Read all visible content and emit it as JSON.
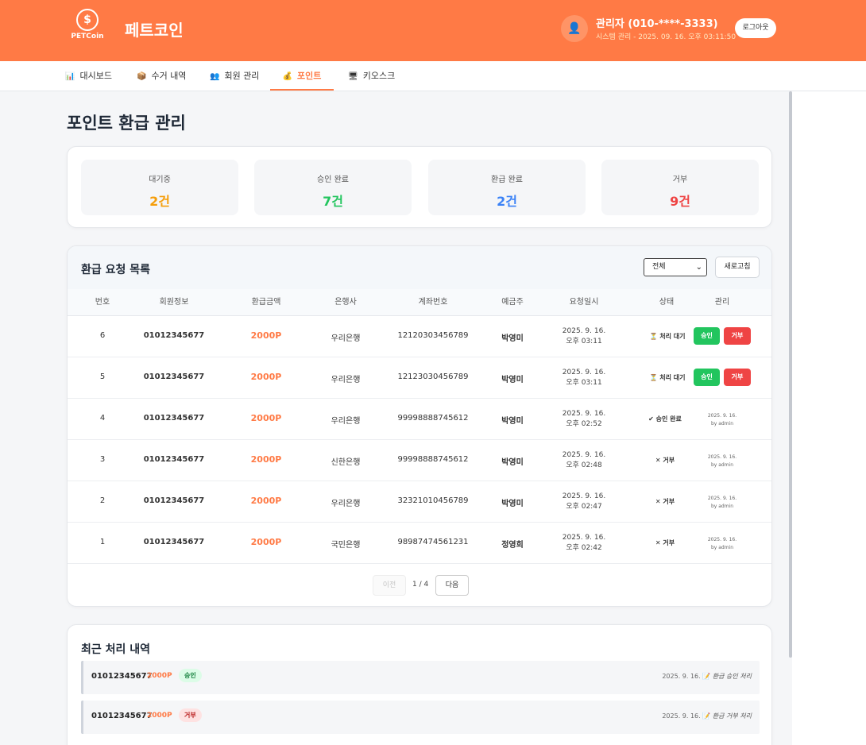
{
  "header": {
    "logo_text": "PETCoin",
    "brand": "페트코인",
    "admin_name": "관리자 (010-****-3333)",
    "admin_sub": "시스템 관리 - 2025. 09. 16. 오후 03:11:50",
    "logout": "로그아웃"
  },
  "nav": [
    {
      "icon": "📊",
      "label": "대시보드"
    },
    {
      "icon": "📦",
      "label": "수거 내역"
    },
    {
      "icon": "👥",
      "label": "회원 관리"
    },
    {
      "icon": "💰",
      "label": "포인트"
    },
    {
      "icon": "🖥",
      "label": "키오스크"
    }
  ],
  "page_title": "포인트 환급 관리",
  "stats": [
    {
      "label": "대기중",
      "value": "2건",
      "color": "#f59e0b"
    },
    {
      "label": "승인 완료",
      "value": "7건",
      "color": "#22c55e"
    },
    {
      "label": "환급 완료",
      "value": "2건",
      "color": "#3b82f6"
    },
    {
      "label": "거부",
      "value": "9건",
      "color": "#ef4444"
    }
  ],
  "list": {
    "title": "환급 요청 목록",
    "filter": "전체",
    "refresh": "새로고침",
    "columns": [
      "번호",
      "회원정보",
      "환급금액",
      "은행사",
      "계좌번호",
      "예금주",
      "요청일시",
      "상태",
      "관리"
    ],
    "rows": [
      {
        "no": "6",
        "member": "01012345677",
        "amount": "2000P",
        "bank": "우리은행",
        "account": "12120303456789",
        "holder": "박영미",
        "date1": "2025. 9. 16.",
        "date2": "오후 03:11",
        "status": "⏳ 처리 대기",
        "status_color": "#333333",
        "approve": "승인",
        "reject": "거부"
      },
      {
        "no": "5",
        "member": "01012345677",
        "amount": "2000P",
        "bank": "우리은행",
        "account": "12123030456789",
        "holder": "박영미",
        "date1": "2025. 9. 16.",
        "date2": "오후 03:11",
        "status": "⏳ 처리 대기",
        "status_color": "#333333",
        "approve": "승인",
        "reject": "거부"
      },
      {
        "no": "4",
        "member": "01012345677",
        "amount": "2000P",
        "bank": "우리은행",
        "account": "99998888745612",
        "holder": "박영미",
        "date1": "2025. 9. 16.",
        "date2": "오후 02:52",
        "status": "✔ 승인 완료",
        "status_color": "#333333",
        "note1": "2025. 9. 16.",
        "note2": "by admin"
      },
      {
        "no": "3",
        "member": "01012345677",
        "amount": "2000P",
        "bank": "신한은행",
        "account": "99998888745612",
        "holder": "박영미",
        "date1": "2025. 9. 16.",
        "date2": "오후 02:48",
        "status": "✕ 거부",
        "status_color": "#333333",
        "note1": "2025. 9. 16.",
        "note2": "by admin"
      },
      {
        "no": "2",
        "member": "01012345677",
        "amount": "2000P",
        "bank": "우리은행",
        "account": "32321010456789",
        "holder": "박영미",
        "date1": "2025. 9. 16.",
        "date2": "오후 02:47",
        "status": "✕ 거부",
        "status_color": "#333333",
        "note1": "2025. 9. 16.",
        "note2": "by admin"
      },
      {
        "no": "1",
        "member": "01012345677",
        "amount": "2000P",
        "bank": "국민은행",
        "account": "98987474561231",
        "holder": "정영희",
        "date1": "2025. 9. 16.",
        "date2": "오후 02:42",
        "status": "✕ 거부",
        "status_color": "#333333",
        "note1": "2025. 9. 16.",
        "note2": "by admin"
      }
    ],
    "pager": {
      "prev": "이전",
      "info": "1 / 4",
      "next": "다음"
    }
  },
  "recent": {
    "title": "최근 처리 내역",
    "items": [
      {
        "member": "01012345677",
        "amount": "2000P",
        "badge": "승인",
        "date": "2025. 9. 16.",
        "note": "환급 승인 처리"
      },
      {
        "member": "01012345677",
        "amount": "2000P",
        "badge": "거부",
        "date": "2025. 9. 16.",
        "note": "환급 거부 처리"
      }
    ]
  }
}
